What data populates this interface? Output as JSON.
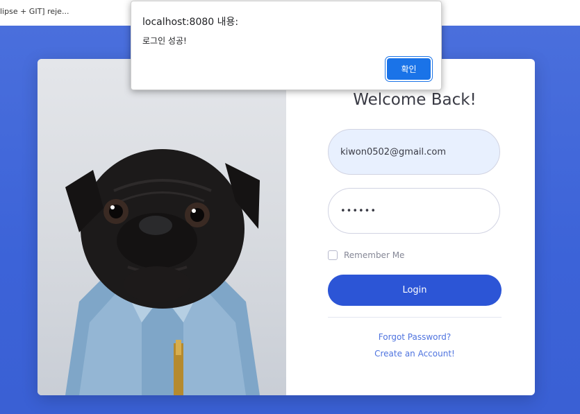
{
  "browser": {
    "tab_title": "lipse + GIT] reje..."
  },
  "login": {
    "heading": "Welcome Back!",
    "email_value": "kiwon0502@gmail.com",
    "password_value": "••••••",
    "remember_label": "Remember Me",
    "remember_checked": false,
    "login_label": "Login",
    "forgot_label": "Forgot Password?",
    "create_label": "Create an Account!"
  },
  "alert": {
    "title": "localhost:8080 내용:",
    "message": "로그인 성공!",
    "ok_label": "확인"
  },
  "colors": {
    "background": "#4a6fdc",
    "primary_button": "#2c55d6",
    "link": "#4e73df",
    "dialog_button": "#1a73e8"
  }
}
